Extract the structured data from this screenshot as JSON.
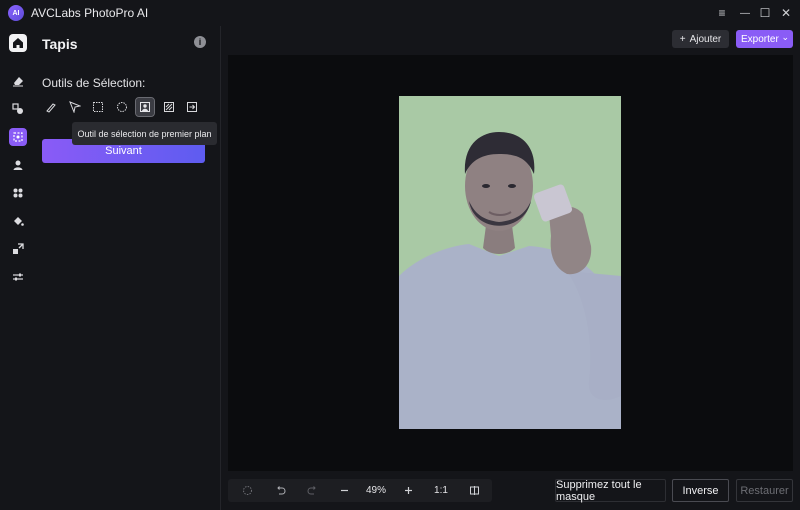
{
  "app": {
    "title": "AVCLabs PhotoPro AI",
    "logo_text": "AI"
  },
  "window_controls": {
    "menu_icon": "≡",
    "minimize_icon": "—",
    "maximize_icon": "☐",
    "close_icon": "✕"
  },
  "rail": {
    "items": [
      "home-icon",
      "eraser-icon",
      "replace-object-icon",
      "selection-tool-icon",
      "portrait-icon",
      "blur-icon",
      "fill-icon",
      "upscale-icon",
      "adjust-icon"
    ],
    "active": "selection-tool-icon"
  },
  "panel": {
    "title": "Tapis",
    "info_icon": "i",
    "section_label": "Outils de Sélection:",
    "tools": [
      "brush-icon",
      "pointer-icon",
      "rectangle-select-icon",
      "ellipse-select-icon",
      "foreground-select-icon",
      "hatch-select-icon",
      "import-mask-icon"
    ],
    "selected_tool": "foreground-select-icon",
    "tooltip": "Outil de sélection de premier plan",
    "next_label": "Suivant"
  },
  "toolbar": {
    "add_label": "Ajouter",
    "add_icon": "+",
    "export_label": "Exporter",
    "export_caret": "⌄"
  },
  "bottom": {
    "zoom_value": "49%",
    "ratio_label": "1:1",
    "delete_mask_label": "Supprimez tout le masque",
    "inverse_label": "Inverse",
    "restore_label": "Restaurer"
  },
  "colors": {
    "accent": "#8a5cf6",
    "background": "#141519",
    "canvas": "#0b0c0e",
    "photo_background": "#a7c7a6"
  }
}
